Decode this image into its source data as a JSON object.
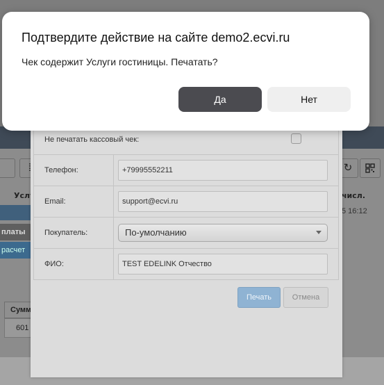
{
  "confirm_dialog": {
    "title": "Подтвердите действие на сайте demo2.ecvi.ru",
    "message": "Чек содержит Услуги гостиницы. Печатать?",
    "yes_label": "Да",
    "no_label": "Нет"
  },
  "receipt_form": {
    "no_print_label": "Не печатать кассовый чек:",
    "no_print_checked": false,
    "phone_label": "Телефон:",
    "phone_value": "+79995552211",
    "email_label": "Email:",
    "email_value": "support@ecvi.ru",
    "buyer_label": "Покупатель:",
    "buyer_value": "По-умолчанию",
    "name_label": "ФИО:",
    "name_value": "TEST EDELINK Отчество",
    "print_label": "Печать",
    "cancel_label": "Отмена"
  },
  "background": {
    "col_services": "Услу",
    "col_number": "числ.",
    "row_payment": "платы",
    "row_calc": "расчет",
    "time_text": "5 16:12",
    "sum_header": "Сумм",
    "sum_value": "601",
    "icon_names": [
      "refresh-icon",
      "qr-code-icon",
      "grid-icon"
    ]
  },
  "colors": {
    "overlay": "#8a8a8a",
    "confirm_yes_bg": "#4b4b50",
    "confirm_no_bg": "#efefef",
    "print_button_bg": "#8fb3d3"
  }
}
